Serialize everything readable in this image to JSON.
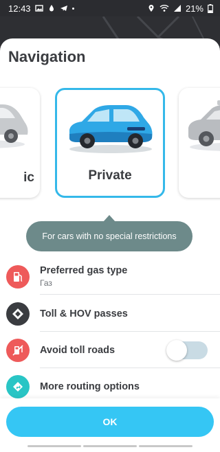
{
  "status_bar": {
    "time": "12:43",
    "battery": "21%",
    "icons": [
      "image-icon",
      "drop-icon",
      "telegram-icon",
      "location-icon",
      "wifi-icon",
      "signal-icon",
      "battery-icon"
    ]
  },
  "sheet": {
    "title": "Navigation"
  },
  "vehicles": [
    {
      "label": "ic",
      "icon": "car-icon",
      "selected": false
    },
    {
      "label": "Private",
      "icon": "car-icon",
      "selected": true
    },
    {
      "label": "",
      "icon": "taxi-icon",
      "selected": false
    }
  ],
  "tooltip": {
    "text": "For cars with no special restrictions"
  },
  "options": [
    {
      "label": "Preferred gas type",
      "sublabel": "Газ",
      "icon": "gas-pump-icon",
      "icon_color": "#ee5a5a"
    },
    {
      "label": "Toll & HOV passes",
      "sublabel": "",
      "icon": "diamond-icon",
      "icon_color": "#3a3c40"
    },
    {
      "label": "Avoid toll roads",
      "sublabel": "",
      "icon": "no-toll-icon",
      "icon_color": "#ee5a5a",
      "toggle": false
    },
    {
      "label": "More routing options",
      "sublabel": "",
      "icon": "routing-icon",
      "icon_color": "#29c5c5"
    }
  ],
  "footer": {
    "ok_label": "OK",
    "accent": "#35c6f4"
  }
}
